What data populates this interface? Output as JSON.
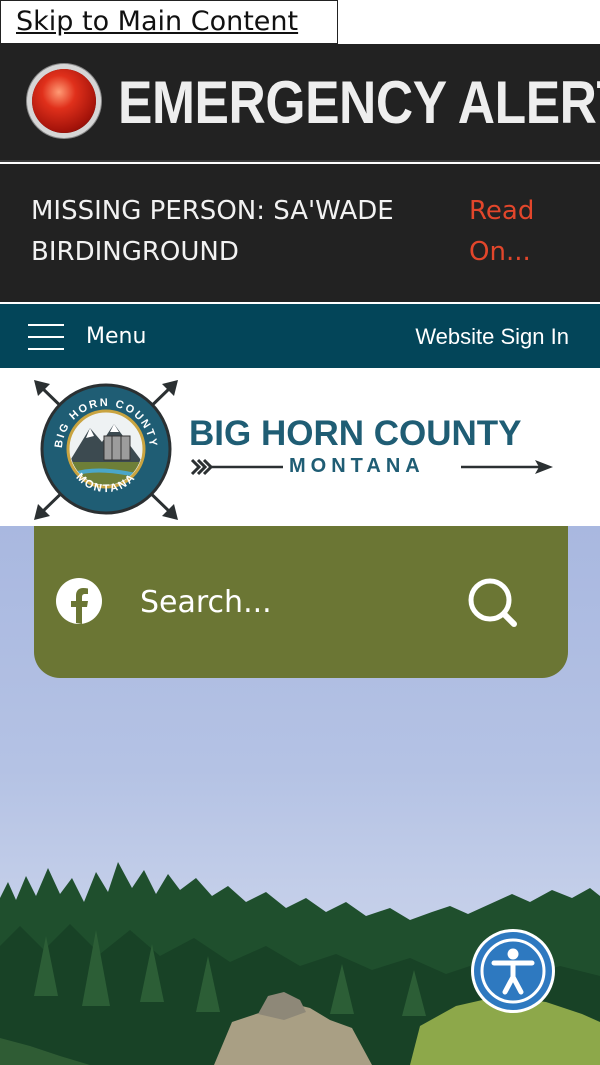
{
  "skip_link": {
    "label": "Skip to Main Content"
  },
  "alert": {
    "title": "EMERGENCY ALERT",
    "message": "MISSING PERSON: SA'WADE BIRDINGROUND",
    "read_more": "Read On..."
  },
  "nav": {
    "menu_label": "Menu",
    "sign_in_label": "Website Sign In"
  },
  "logo": {
    "title": "BIG HORN COUNTY",
    "subtitle": "MONTANA",
    "seal_top": "BIG HORN COUNTY",
    "seal_bottom": "MONTANA"
  },
  "search": {
    "placeholder": "Search..."
  },
  "icons": {
    "alert": "alert-light-icon",
    "menu": "hamburger-menu-icon",
    "facebook": "facebook-icon",
    "search": "search-icon",
    "accessibility": "accessibility-icon"
  },
  "colors": {
    "alert_bg": "#222222",
    "alert_link": "#e2462b",
    "nav_bg": "#034559",
    "brand_text": "#1f5d74",
    "search_panel": "#6b7634",
    "accessibility_button": "#2e79c0"
  }
}
